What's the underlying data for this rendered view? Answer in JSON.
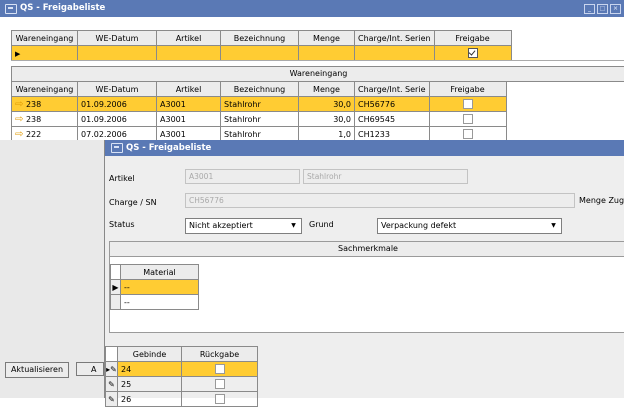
{
  "window": {
    "title": "QS - Freigabeliste"
  },
  "filter_table": {
    "headers": [
      "Wareneingang",
      "WE-Datum",
      "Artikel",
      "Bezeichnung",
      "Menge",
      "Charge/Int. Serien",
      "Freigabe"
    ],
    "freigabe_checked": true
  },
  "main_table": {
    "group_header": "Wareneingang",
    "headers": [
      "Wareneingang",
      "WE-Datum",
      "Artikel",
      "Bezeichnung",
      "Menge",
      "Charge/Int. Serie",
      "Freigabe"
    ],
    "rows": [
      {
        "wareneingang": "238",
        "datum": "01.09.2006",
        "artikel": "A3001",
        "bezeichnung": "Stahlrohr",
        "menge": "30,0",
        "charge": "CH56776"
      },
      {
        "wareneingang": "238",
        "datum": "01.09.2006",
        "artikel": "A3001",
        "bezeichnung": "Stahlrohr",
        "menge": "30,0",
        "charge": "CH69545"
      },
      {
        "wareneingang": "222",
        "datum": "07.02.2006",
        "artikel": "A3001",
        "bezeichnung": "Stahlrohr",
        "menge": "1,0",
        "charge": "CH1233"
      }
    ]
  },
  "buttons": {
    "aktualisieren": "Aktualisieren",
    "second": "A"
  },
  "dialog": {
    "title": "QS - Freigabeliste",
    "artikel_label": "Artikel",
    "artikel_value": "A3001",
    "artikel_bez": "Stahlrohr",
    "charge_label": "Charge / SN",
    "charge_value": "CH56776",
    "menge_label": "Menge Zug",
    "status_label": "Status",
    "status_value": "Nicht akzeptiert",
    "grund_label": "Grund",
    "grund_value": "Verpackung defekt",
    "sachmerkmale": "Sachmerkmale",
    "material_header": "Material",
    "material_rows": [
      "--",
      "--"
    ],
    "gebinde_headers": [
      "Gebinde",
      "Rückgabe"
    ],
    "gebinde_rows": [
      "24",
      "25",
      "26"
    ]
  },
  "colors": {
    "title_bar": "#5a79b5",
    "selection": "#ffcc33",
    "arrow": "#e09a00"
  }
}
